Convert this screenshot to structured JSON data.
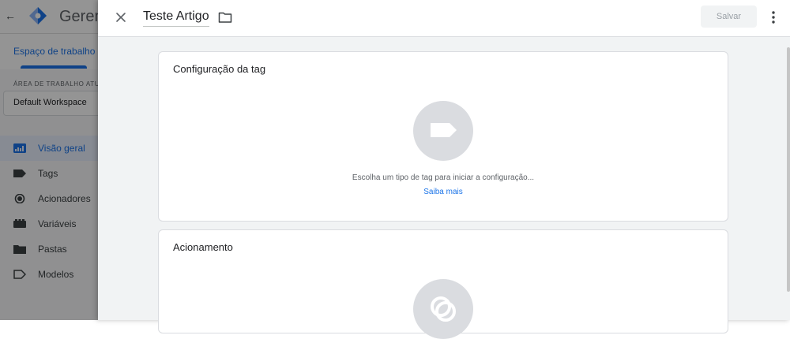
{
  "background_app": {
    "back_glyph": "←",
    "title": "Gerenc",
    "tabs": {
      "workspace": "Espaço de trabalho"
    },
    "sidebar": {
      "workspace_label": "ÁREA DE TRABALHO ATU",
      "workspace_value": "Default Workspace",
      "items": [
        {
          "label": "Visão geral",
          "icon": "overview-icon",
          "active": true
        },
        {
          "label": "Tags",
          "icon": "tag-icon"
        },
        {
          "label": "Acionadores",
          "icon": "trigger-icon"
        },
        {
          "label": "Variáveis",
          "icon": "variable-icon"
        },
        {
          "label": "Pastas",
          "icon": "folder-icon"
        },
        {
          "label": "Modelos",
          "icon": "template-icon"
        }
      ]
    }
  },
  "panel": {
    "tag_name": "Teste Artigo",
    "save_label": "Salvar",
    "config_card": {
      "title": "Configuração da tag",
      "hint": "Escolha um tipo de tag para iniciar a configuração...",
      "learn_more": "Saiba mais"
    },
    "trigger_card": {
      "title": "Acionamento"
    }
  },
  "colors": {
    "accent": "#1a73e8",
    "placeholder_circle": "#dadce0",
    "panel_bg": "#f1f3f4"
  }
}
